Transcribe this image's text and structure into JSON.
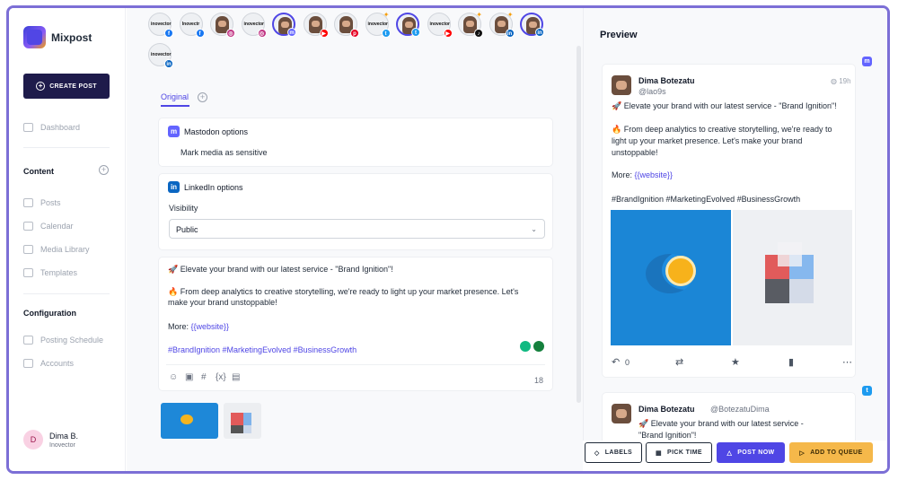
{
  "app": {
    "name": "Mixpost"
  },
  "sidebar": {
    "create_label": "CREATE POST",
    "dashboard": "Dashboard",
    "content_title": "Content",
    "content_items": [
      "Posts",
      "Calendar",
      "Media Library",
      "Templates"
    ],
    "config_title": "Configuration",
    "config_items": [
      "Posting Schedule",
      "Accounts"
    ],
    "user": {
      "initial": "D",
      "name": "Dima B.",
      "org": "Inovector"
    }
  },
  "accounts": [
    {
      "kind": "logo",
      "label": "inovector",
      "network": "facebook",
      "selected": false
    },
    {
      "kind": "logo",
      "label": "Inovectr",
      "network": "facebook",
      "selected": false
    },
    {
      "kind": "face",
      "network": "instagram",
      "selected": false
    },
    {
      "kind": "logo",
      "label": "inovector",
      "network": "instagram",
      "selected": false
    },
    {
      "kind": "face",
      "network": "mastodon",
      "selected": true
    },
    {
      "kind": "face",
      "network": "youtube",
      "selected": false
    },
    {
      "kind": "face",
      "network": "pinterest",
      "selected": false
    },
    {
      "kind": "logo",
      "label": "inovector",
      "network": "twitter",
      "selected": false,
      "spark": true
    },
    {
      "kind": "face",
      "network": "twitter",
      "selected": true
    },
    {
      "kind": "logo",
      "label": "inovector",
      "network": "youtube",
      "selected": false
    },
    {
      "kind": "face",
      "network": "tiktok",
      "selected": false,
      "spark": true
    },
    {
      "kind": "face",
      "network": "linkedin",
      "selected": false,
      "spark": true
    },
    {
      "kind": "face",
      "network": "linkedin",
      "selected": true
    },
    {
      "kind": "logo",
      "label": "inovector",
      "network": "linkedin",
      "selected": false
    }
  ],
  "editor": {
    "tab_original": "Original",
    "mastodon": {
      "title": "Mastodon options",
      "sensitive_label": "Mark media as sensitive"
    },
    "linkedin": {
      "title": "LinkedIn options",
      "visibility_label": "Visibility",
      "visibility_value": "Public"
    },
    "post": {
      "line1": "🚀 Elevate your brand with our latest service - \"Brand Ignition\"!",
      "line2": "🔥 From deep analytics to creative storytelling, we're ready to light up your market presence. Let's make your brand unstoppable!",
      "more_prefix": "More: ",
      "more_link": "{{website}}",
      "hashtags": "#BrandIgnition #MarketingEvolved #BusinessGrowth"
    },
    "char_count": "18",
    "toolbar_icons": [
      "emoji-icon",
      "image-icon",
      "hashtag-icon",
      "variable-icon",
      "template-icon"
    ]
  },
  "preview": {
    "title": "Preview",
    "mastodon_post": {
      "name": "Dima Botezatu",
      "handle": "@lao9s",
      "time": "19h",
      "line1": "🚀 Elevate your brand with our latest service - \"Brand Ignition\"!",
      "line2": "🔥 From deep analytics to creative storytelling, we're ready to light up your market presence. Let's make your brand unstoppable!",
      "more_prefix": "More: ",
      "more_link": "{{website}}",
      "hashtags": "#BrandIgnition #MarketingEvolved #BusinessGrowth",
      "reply_count": "0"
    },
    "twitter_post": {
      "name": "Dima Botezatu",
      "handle": "@BotezatuDima",
      "line1": "🚀 Elevate your brand with our latest service - \"Brand Ignition\"!"
    }
  },
  "actions": {
    "labels": "LABELS",
    "pick_time": "PICK TIME",
    "post_now": "POST NOW",
    "add_to_queue": "ADD TO QUEUE"
  },
  "colors": {
    "accent": "#4f46e5",
    "mastodon": "#6364ff",
    "twitter": "#1d9bf0",
    "linkedin": "#0a66c2",
    "queue": "#f5b84a"
  }
}
